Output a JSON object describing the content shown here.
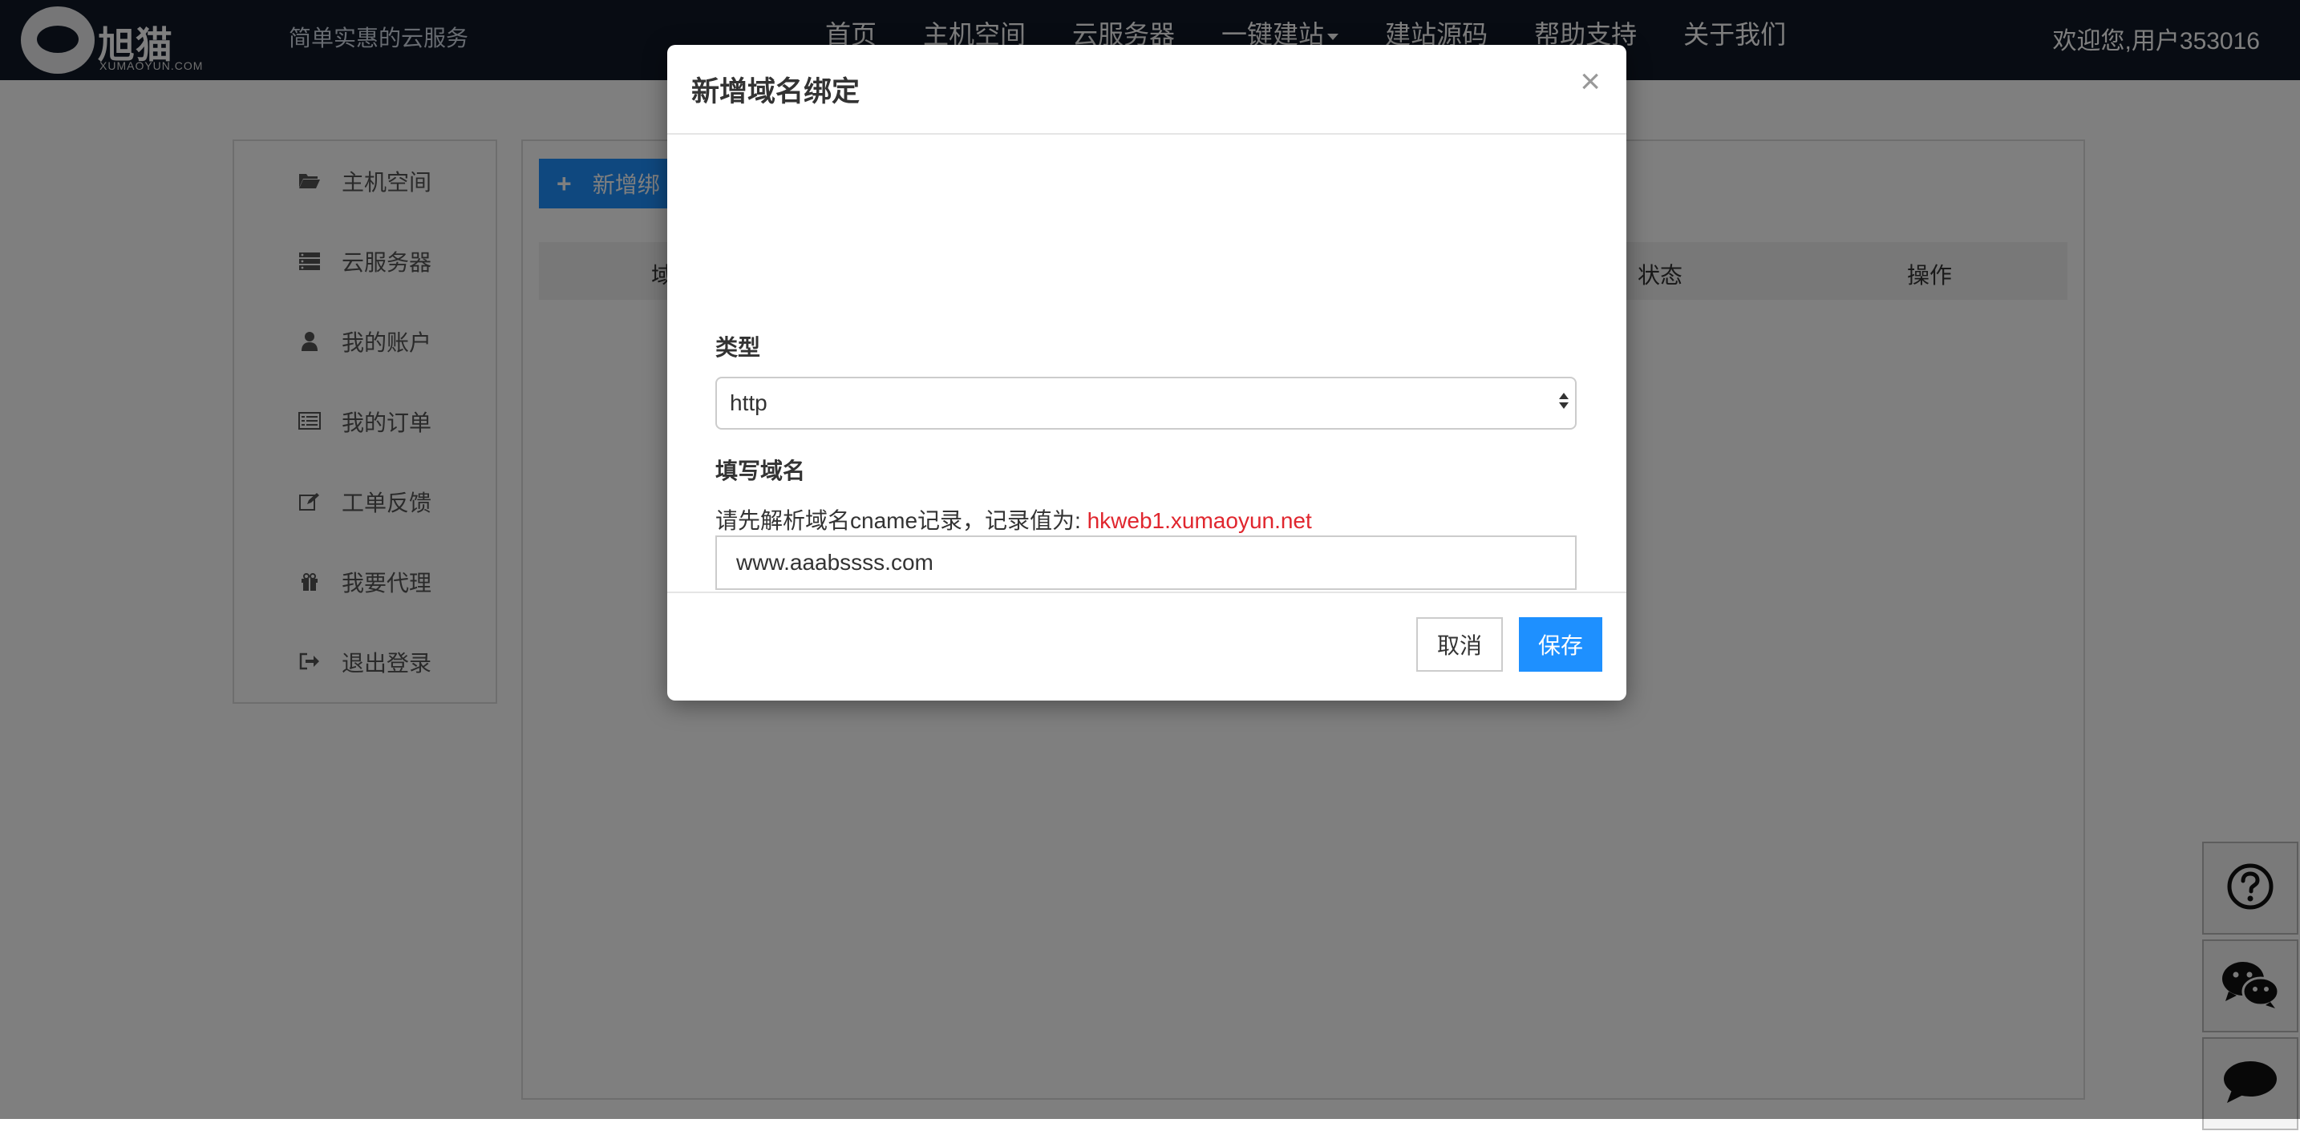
{
  "header": {
    "logo_text": "旭猫云",
    "logo_sub": "XUMAOYUN.COM",
    "slogan": "简单实惠的云服务",
    "nav": [
      {
        "label": "首页"
      },
      {
        "label": "主机空间"
      },
      {
        "label": "云服务器"
      },
      {
        "label": "一键建站"
      },
      {
        "label": "建站源码"
      },
      {
        "label": "帮助支持"
      },
      {
        "label": "关于我们"
      }
    ],
    "welcome": "欢迎您,用户353016"
  },
  "sidebar": {
    "items": [
      {
        "label": "主机空间",
        "icon": "folder-open-icon"
      },
      {
        "label": "云服务器",
        "icon": "server-icon"
      },
      {
        "label": "我的账户",
        "icon": "user-icon"
      },
      {
        "label": "我的订单",
        "icon": "list-icon"
      },
      {
        "label": "工单反馈",
        "icon": "edit-icon"
      },
      {
        "label": "我要代理",
        "icon": "gift-icon"
      },
      {
        "label": "退出登录",
        "icon": "sign-out-icon"
      }
    ]
  },
  "main": {
    "add_button": "新增绑",
    "table_headers": [
      "域",
      "状态",
      "操作"
    ]
  },
  "modal": {
    "title": "新增域名绑定",
    "close": "×",
    "type_label": "类型",
    "type_value": "http",
    "domain_label": "填写域名",
    "hint_prefix": "请先解析域名cname记录，记录值为: ",
    "hint_value": "hkweb1.xumaoyun.net",
    "domain_value": "www.aaabssss.com",
    "cancel": "取消",
    "save": "保存"
  },
  "colors": {
    "nav_bg": "#111827",
    "accent": "#1e90ff",
    "hint_red": "#e0262e"
  }
}
